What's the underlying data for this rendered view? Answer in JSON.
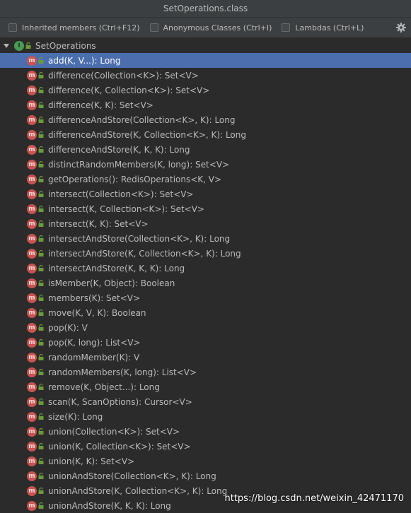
{
  "window": {
    "title": "SetOperations.class"
  },
  "options": [
    {
      "label": "Inherited members (Ctrl+F12)"
    },
    {
      "label": "Anonymous Classes (Ctrl+I)"
    },
    {
      "label": "Lambdas (Ctrl+L)"
    }
  ],
  "icons": {
    "settings": "gear-icon",
    "interface": "interface-icon",
    "method": "method-icon",
    "visibility": "public-lock-icon"
  },
  "colors": {
    "selection": "#4b6eaf",
    "method_badge": "#c75450",
    "interface_badge": "#499c54",
    "lock": "#6a9a3a"
  },
  "tree": {
    "root_label": "SetOperations",
    "root_badge": "I",
    "method_badge": "m",
    "selected_index": 0,
    "members": [
      "add(K, V...): Long",
      "difference(Collection<K>): Set<V>",
      "difference(K, Collection<K>): Set<V>",
      "difference(K, K): Set<V>",
      "differenceAndStore(Collection<K>, K): Long",
      "differenceAndStore(K, Collection<K>, K): Long",
      "differenceAndStore(K, K, K): Long",
      "distinctRandomMembers(K, long): Set<V>",
      "getOperations(): RedisOperations<K, V>",
      "intersect(Collection<K>): Set<V>",
      "intersect(K, Collection<K>): Set<V>",
      "intersect(K, K): Set<V>",
      "intersectAndStore(Collection<K>, K): Long",
      "intersectAndStore(K, Collection<K>, K): Long",
      "intersectAndStore(K, K, K): Long",
      "isMember(K, Object): Boolean",
      "members(K): Set<V>",
      "move(K, V, K): Boolean",
      "pop(K): V",
      "pop(K, long): List<V>",
      "randomMember(K): V",
      "randomMembers(K, long): List<V>",
      "remove(K, Object...): Long",
      "scan(K, ScanOptions): Cursor<V>",
      "size(K): Long",
      "union(Collection<K>): Set<V>",
      "union(K, Collection<K>): Set<V>",
      "union(K, K): Set<V>",
      "unionAndStore(Collection<K>, K): Long",
      "unionAndStore(K, Collection<K>, K): Long",
      "unionAndStore(K, K, K): Long"
    ]
  },
  "watermark": "https://blog.csdn.net/weixin_42471170"
}
